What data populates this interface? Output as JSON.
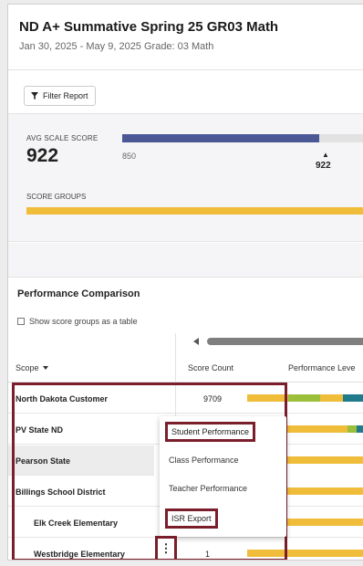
{
  "header": {
    "title": "ND A+ Summative Spring 25 GR03 Math",
    "subtitle": "Jan 30, 2025 - May 9, 2025   Grade: 03   Math"
  },
  "filter": {
    "label": "Filter Report"
  },
  "score": {
    "avg_label": "AVG SCALE SCORE",
    "avg_value": "922",
    "min_tick": "850",
    "marker_value": "922",
    "groups_label": "SCORE GROUPS"
  },
  "performance": {
    "title": "Performance Comparison",
    "checkbox_label": "Show score groups as a table",
    "columns": {
      "scope": "Scope",
      "count": "Score Count",
      "perf": "Performance Leve"
    },
    "rows": [
      {
        "scope": "North Dakota Customer",
        "count": "9709"
      },
      {
        "scope": "PV State ND",
        "count": ""
      },
      {
        "scope": "Pearson State",
        "count": ""
      },
      {
        "scope": "Billings School District",
        "count": ""
      },
      {
        "scope": "Elk Creek Elementary",
        "count": ""
      },
      {
        "scope": "Westbridge Elementary",
        "count": "1"
      }
    ]
  },
  "menu": {
    "items": [
      "Student Performance",
      "Class Performance",
      "Teacher Performance",
      "ISR Export"
    ]
  },
  "kebab": "⋮",
  "colors": {
    "accent": "#4c5796",
    "yellow": "#f0bd3a",
    "green": "#9bbf3b",
    "teal": "#1f7a8c",
    "highlight": "#7a1e2b"
  }
}
